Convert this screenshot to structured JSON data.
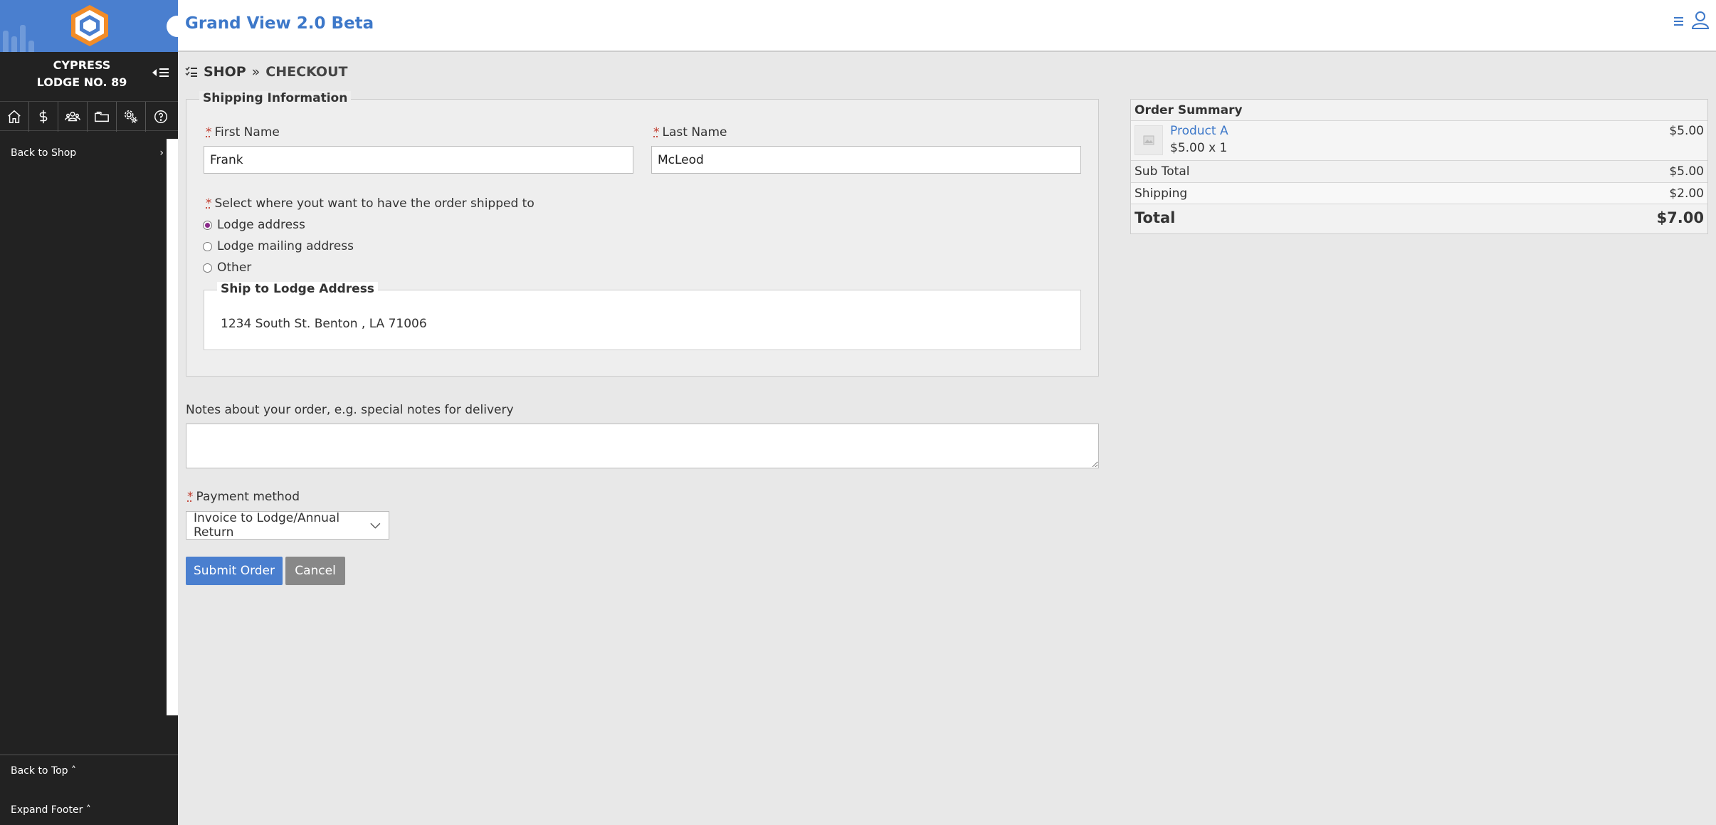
{
  "app": {
    "title": "Grand View 2.0 Beta"
  },
  "sidebar": {
    "lodge_line1": "CYPRESS",
    "lodge_line2": "LODGE NO. 89",
    "nav_icons": [
      "home-icon",
      "dollar-icon",
      "members-icon",
      "folder-icon",
      "settings-icon",
      "help-icon"
    ],
    "back_to_shop": "Back to Shop",
    "back_to_top": "Back to Top",
    "expand_footer": "Expand Footer"
  },
  "breadcrumb": {
    "item1": "SHOP",
    "item2": "CHECKOUT"
  },
  "shipping": {
    "legend": "Shipping Information",
    "first_name_label": "First Name",
    "first_name_value": "Frank",
    "last_name_label": "Last Name",
    "last_name_value": "McLeod",
    "ship_question": "Select where yout want to have the order shipped to",
    "options": [
      "Lodge address",
      "Lodge mailing address",
      "Other"
    ],
    "selected_option": "Lodge address",
    "ship_box_legend": "Ship to Lodge Address",
    "ship_address": "1234 South St. Benton , LA 71006"
  },
  "notes": {
    "label": "Notes about your order, e.g. special notes for delivery",
    "value": ""
  },
  "payment": {
    "label": "Payment method",
    "selected": "Invoice to Lodge/Annual Return"
  },
  "actions": {
    "submit": "Submit Order",
    "cancel": "Cancel"
  },
  "summary": {
    "title": "Order Summary",
    "product_name": "Product A",
    "product_qty": "$5.00 x 1",
    "product_price": "$5.00",
    "subtotal_label": "Sub Total",
    "subtotal_value": "$5.00",
    "shipping_label": "Shipping",
    "shipping_value": "$2.00",
    "total_label": "Total",
    "total_value": "$7.00"
  },
  "colors": {
    "brand_blue": "#4a7fcf",
    "sidebar_bg": "#222222",
    "required": "#c0392b",
    "logo_orange": "#f28c28"
  }
}
